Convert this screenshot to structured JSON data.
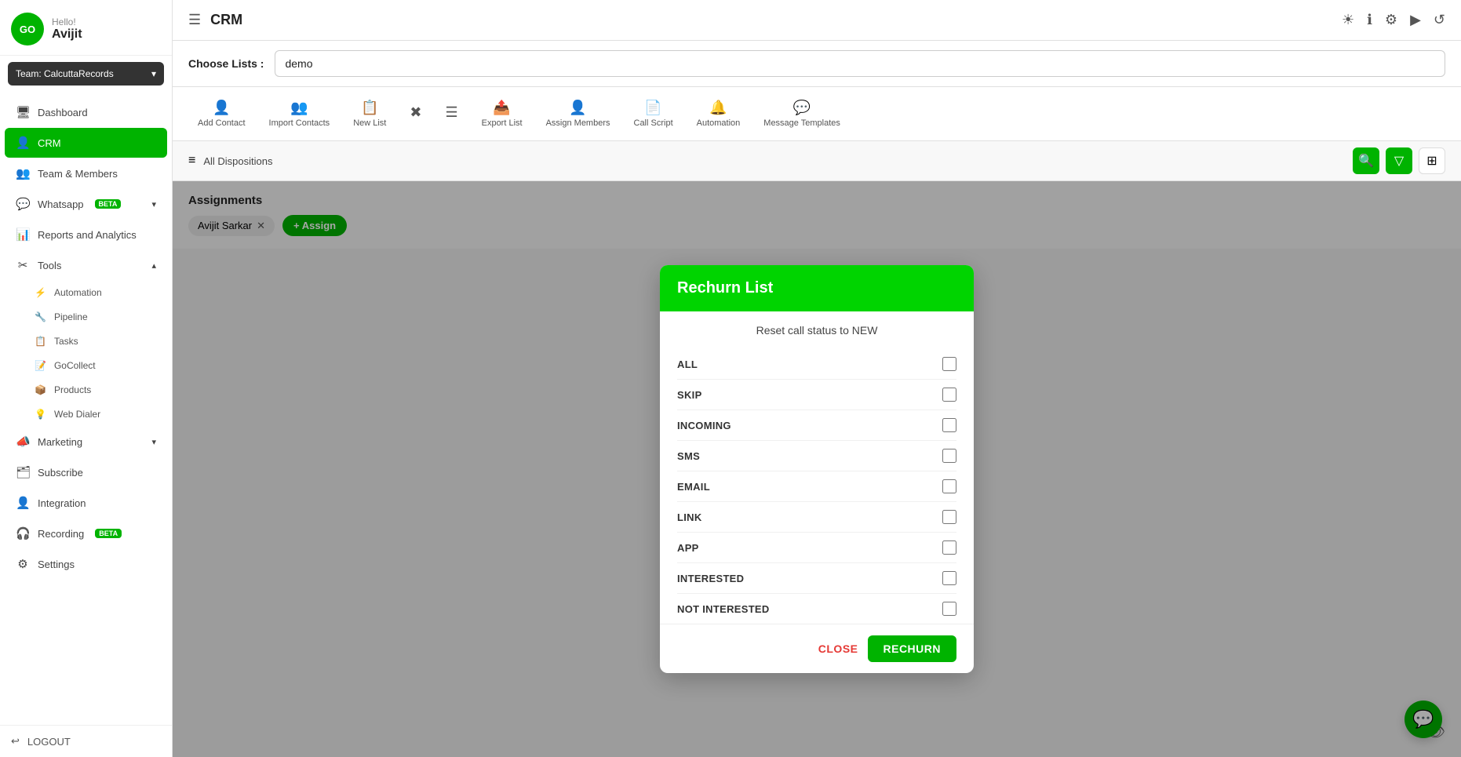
{
  "sidebar": {
    "greeting": "Hello!",
    "user_name": "Avijit",
    "avatar_text": "GO",
    "team_label": "Team: CalcuttaRecords",
    "nav_items": [
      {
        "id": "dashboard",
        "label": "Dashboard",
        "icon": "🖥",
        "active": false
      },
      {
        "id": "crm",
        "label": "CRM",
        "icon": "👤",
        "active": true
      },
      {
        "id": "team",
        "label": "Team & Members",
        "icon": "👥",
        "active": false
      },
      {
        "id": "whatsapp",
        "label": "Whatsapp",
        "icon": "💬",
        "badge": "BETA",
        "active": false,
        "chevron": true
      },
      {
        "id": "reports",
        "label": "Reports and Analytics",
        "icon": "📊",
        "active": false
      },
      {
        "id": "tools",
        "label": "Tools",
        "icon": "✂",
        "active": false,
        "chevron": true,
        "expanded": true
      }
    ],
    "sub_items": [
      {
        "id": "automation",
        "label": "Automation",
        "icon": "⚡"
      },
      {
        "id": "pipeline",
        "label": "Pipeline",
        "icon": "🔧"
      },
      {
        "id": "tasks",
        "label": "Tasks",
        "icon": "📋"
      },
      {
        "id": "gocollect",
        "label": "GoCollect",
        "icon": "📝"
      },
      {
        "id": "products",
        "label": "Products",
        "icon": "📦"
      },
      {
        "id": "webdialer",
        "label": "Web Dialer",
        "icon": "💡"
      }
    ],
    "bottom_items": [
      {
        "id": "marketing",
        "label": "Marketing",
        "icon": "📣",
        "chevron": true
      },
      {
        "id": "subscribe",
        "label": "Subscribe",
        "icon": "🗂"
      },
      {
        "id": "integration",
        "label": "Integration",
        "icon": "👤"
      },
      {
        "id": "recording",
        "label": "Recording",
        "icon": "🎧",
        "badge": "BETA"
      },
      {
        "id": "settings",
        "label": "Settings",
        "icon": "⚙"
      }
    ],
    "logout_label": "LOGOUT"
  },
  "topbar": {
    "title": "CRM",
    "icons": [
      "☀",
      "ℹ",
      "⚙",
      "▶",
      "↺"
    ]
  },
  "choose_lists": {
    "label": "Choose Lists :",
    "selected": "demo"
  },
  "toolbar": {
    "buttons": [
      {
        "id": "add-contact",
        "label": "Add Contact",
        "icon": "👤"
      },
      {
        "id": "import-contacts",
        "label": "Import Contacts",
        "icon": "👥"
      },
      {
        "id": "new-list",
        "label": "New List",
        "icon": "📋"
      },
      {
        "id": "delete-list",
        "label": "",
        "icon": "✂"
      },
      {
        "id": "filter-list",
        "label": "",
        "icon": "☰"
      },
      {
        "id": "export-list",
        "label": "Export List",
        "icon": "📤"
      },
      {
        "id": "assign-members",
        "label": "Assign Members",
        "icon": "👤"
      },
      {
        "id": "call-script",
        "label": "Call Script",
        "icon": "📄"
      },
      {
        "id": "automation",
        "label": "Automation",
        "icon": "🔔"
      },
      {
        "id": "message-templates",
        "label": "Message Templates",
        "icon": "💬"
      }
    ]
  },
  "filters": {
    "label": "All Dispositions",
    "filter_icon": "≡"
  },
  "assignments": {
    "title": "Assignments",
    "assignee": "Avijit Sarkar",
    "assign_label": "+ Assign"
  },
  "modal": {
    "title": "Rechurn List",
    "subtitle": "Reset call status to NEW",
    "checkboxes": [
      {
        "id": "all",
        "label": "ALL"
      },
      {
        "id": "skip",
        "label": "SKIP"
      },
      {
        "id": "incoming",
        "label": "INCOMING"
      },
      {
        "id": "sms",
        "label": "SMS"
      },
      {
        "id": "email",
        "label": "EMAIL"
      },
      {
        "id": "link",
        "label": "LINK"
      },
      {
        "id": "app",
        "label": "APP"
      },
      {
        "id": "interested",
        "label": "INTERESTED"
      },
      {
        "id": "not_interested",
        "label": "NOT INTERESTED"
      }
    ],
    "close_label": "CLOSE",
    "rechurn_label": "RECHURN"
  },
  "chat_fab_icon": "💬"
}
